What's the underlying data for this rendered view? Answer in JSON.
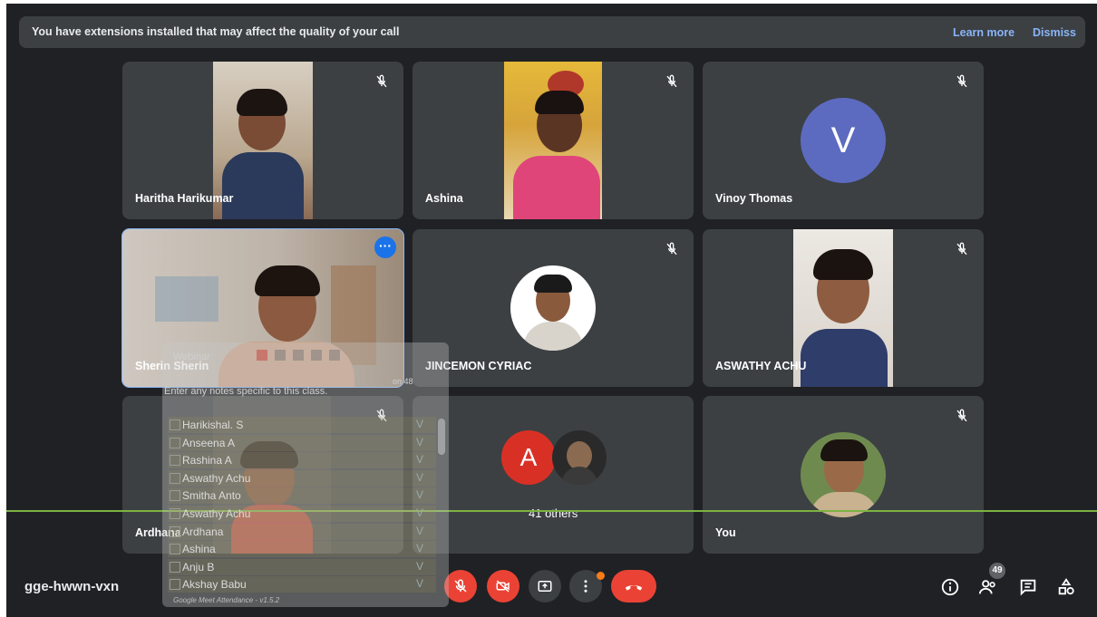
{
  "banner": {
    "message": "You have extensions installed that may affect the quality of your call",
    "learn_more": "Learn more",
    "dismiss": "Dismiss"
  },
  "tiles": [
    {
      "name": "Haritha Harikumar",
      "muted": true
    },
    {
      "name": "Ashina",
      "muted": true
    },
    {
      "name": "Vinoy Thomas",
      "muted": true,
      "avatar_letter": "V",
      "avatar_color": "#5c6bc0"
    },
    {
      "name": "Sherin Sherin",
      "muted": false,
      "active": true
    },
    {
      "name": "JINCEMON CYRIAC",
      "muted": true
    },
    {
      "name": "ASWATHY ACHU",
      "muted": true
    },
    {
      "name": "Ardhana",
      "muted": true
    },
    {
      "name": "41 others",
      "avatar_letter": "A",
      "avatar_color": "#d93025"
    },
    {
      "name": "You",
      "muted": true
    }
  ],
  "extension": {
    "title": "Webinar",
    "session_hint": "on 48",
    "notes_placeholder": "Enter any notes specific to this class.",
    "attendees": [
      "Harikishal. S",
      "Anseena A",
      "Rashina A",
      "Aswathy Achu",
      "Smitha Anto",
      "Aswathy Achu",
      "Ardhana",
      "Ashina",
      "Anju B",
      "Akshay Babu"
    ],
    "footer": "Google Meet Attendance - v1.5.2"
  },
  "bottom_bar": {
    "meeting_code": "gge-hwwn-vxn",
    "participants_count": "49"
  },
  "colors": {
    "background": "#202124",
    "tile": "#3c4043",
    "accent": "#8ab4f8",
    "danger": "#ea4335",
    "divider": "#7cb342"
  },
  "icons": [
    "mic-off-icon",
    "camera-off-icon",
    "present-icon",
    "more-vert-icon",
    "end-call-icon",
    "info-icon",
    "people-icon",
    "chat-icon",
    "activities-icon"
  ]
}
